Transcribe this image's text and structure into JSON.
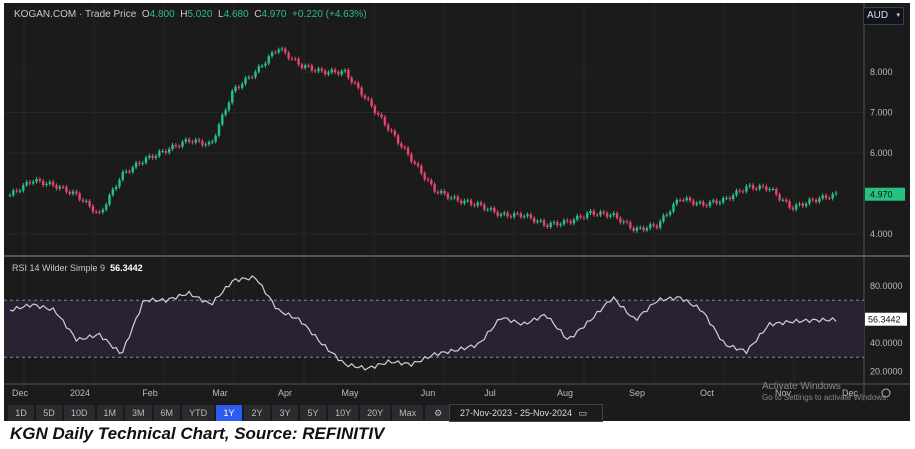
{
  "header": {
    "symbol": "KOGAN.COM",
    "price_type": "Trade Price",
    "open_label": "O",
    "open": "4.800",
    "high_label": "H",
    "high": "5.020",
    "low_label": "L",
    "low": "4.680",
    "close_label": "C",
    "close": "4.970",
    "change": "+0.220 (+4.63%)",
    "currency": "AUD"
  },
  "price_axis": {
    "ticks": [
      "8.000",
      "7.000",
      "6.000",
      "4.000"
    ],
    "last_price": "4.970"
  },
  "rsi": {
    "label": "RSI 14 Wilder Simple 9",
    "value": "56.3442",
    "ticks": [
      "80.0000",
      "40.0000",
      "20.0000"
    ],
    "bands": [
      30,
      70
    ]
  },
  "date_axis": [
    "Dec",
    "2024",
    "Feb",
    "Mar",
    "Apr",
    "May",
    "Jun",
    "Jul",
    "Aug",
    "Sep",
    "Oct",
    "Nov",
    "Dec"
  ],
  "toolbar": {
    "ranges": [
      "1D",
      "5D",
      "10D",
      "1M",
      "3M",
      "6M",
      "YTD",
      "1Y",
      "2Y",
      "3Y",
      "5Y",
      "10Y",
      "20Y",
      "Max"
    ],
    "active": "1Y",
    "date_range": "27-Nov-2023 - 25-Nov-2024"
  },
  "watermark": {
    "line1": "Activate Windows",
    "line2": "Go to Settings to activate Windows."
  },
  "caption": "KGN Daily Technical Chart, Source: REFINITIV",
  "colors": {
    "up": "#26c281",
    "down": "#e8456b",
    "rsi_line": "#d0d0d0",
    "band_fill": "#2a2233",
    "last_price_bg": "#26c281",
    "active_range": "#2c5cf0"
  },
  "chart_data": {
    "type": "candlestick",
    "price_close_path": [
      4.96,
      5.33,
      5.2,
      4.96,
      4.47,
      5.46,
      5.83,
      6.07,
      6.32,
      6.2,
      7.55,
      8.0,
      8.6,
      8.17,
      8.0,
      8.0,
      7.3,
      6.57,
      5.83,
      5.09,
      4.84,
      4.72,
      4.47,
      4.47,
      4.22,
      4.3,
      4.52,
      4.47,
      4.1,
      4.22,
      4.89,
      4.72,
      4.84,
      5.16,
      5.14,
      4.64,
      4.84,
      4.97
    ],
    "rsi_path": [
      63,
      67,
      63,
      42,
      46,
      32,
      70,
      70,
      75,
      67,
      84,
      86,
      63,
      56,
      39,
      25,
      22,
      27,
      25,
      32,
      35,
      39,
      58,
      53,
      60,
      42,
      56,
      72,
      56,
      70,
      72,
      63,
      39,
      34,
      53,
      55,
      56,
      56.34
    ]
  }
}
